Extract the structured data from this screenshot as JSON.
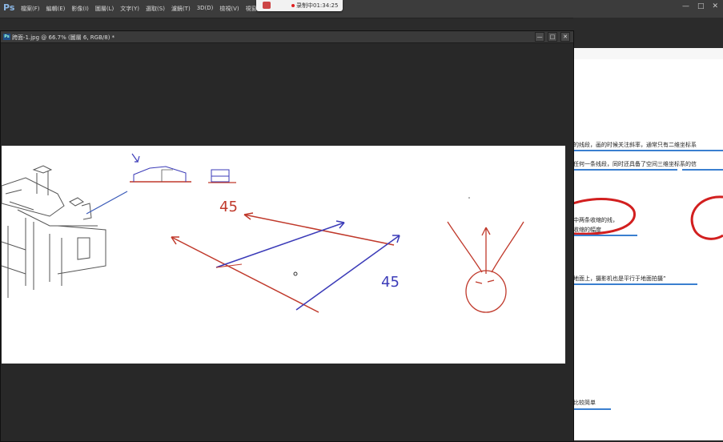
{
  "app": {
    "logo": "Ps",
    "menus": [
      "檔案(F)",
      "編輯(E)",
      "影像(I)",
      "圖層(L)",
      "文字(Y)",
      "選取(S)",
      "濾鏡(T)",
      "3D(D)",
      "檢視(V)",
      "視窗(W)"
    ],
    "window_controls": [
      "—",
      "□",
      "✕"
    ]
  },
  "recording": {
    "text": "录制中01:34:25"
  },
  "document": {
    "title": "跨面-1.jpg @ 66.7% (圖層 6, RGB/8) *",
    "controls": [
      "—",
      "□",
      "✕"
    ]
  },
  "sketch": {
    "label_left": "45",
    "label_right": "45"
  },
  "right_page": {
    "lines": [
      "的线段，画的时候关注斜率，通常只有二维坐标系",
      "任何一条线段，同时还具备了空间三维坐标系的信",
      "中两条收缩的线，",
      "收缩的幅度",
      "地面上，摄影机也是平行于地面拍摄”",
      "比较简单"
    ]
  },
  "colors": {
    "menubar": "#3c3c3c",
    "workspace": "#262626",
    "sketch_red": "#c0392b",
    "sketch_blue": "#3b3bb8",
    "underline_blue": "#3a7fd0"
  }
}
